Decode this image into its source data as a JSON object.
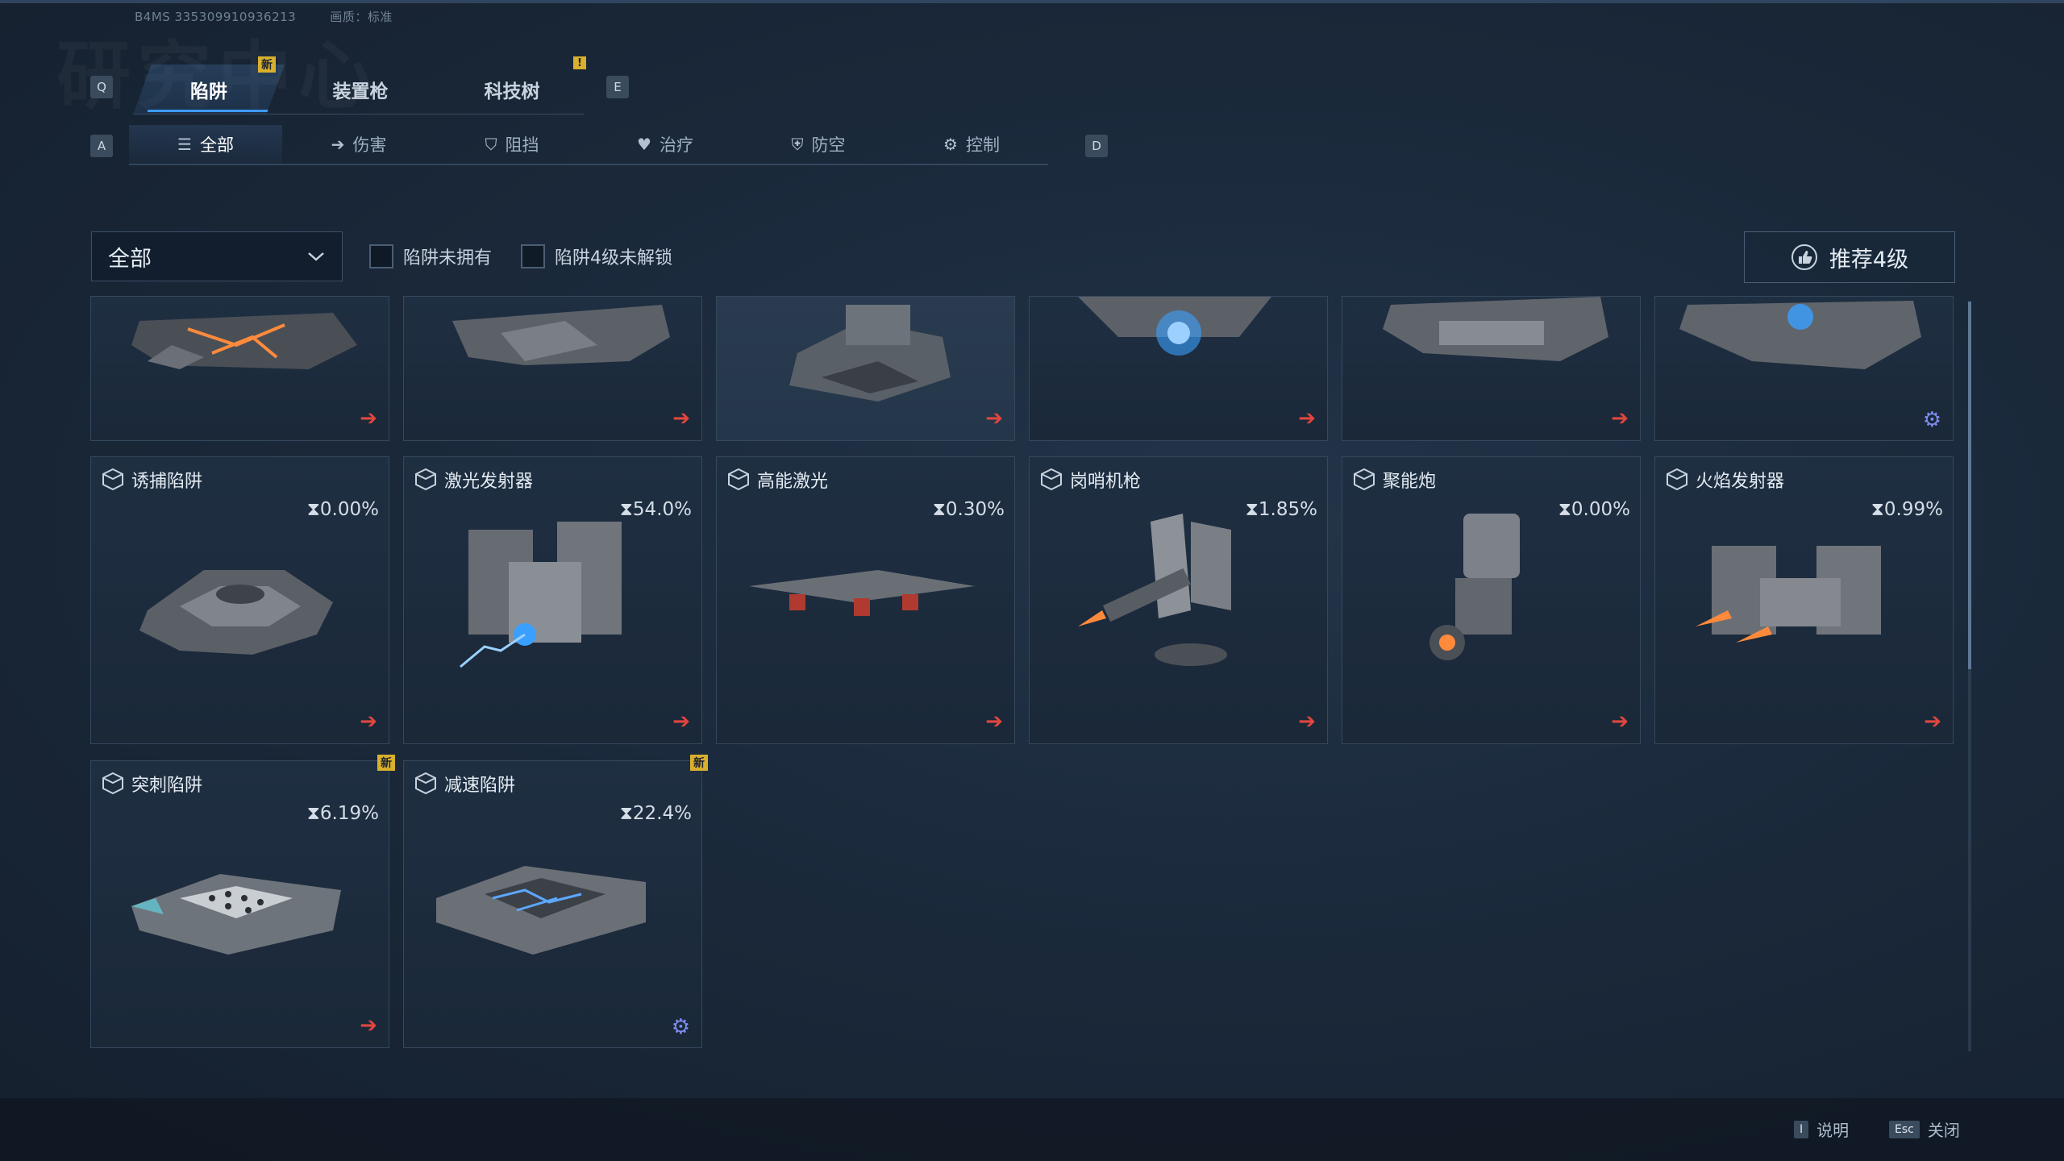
{
  "header": {
    "build_id": "B4MS  3353099109362​13",
    "quality": "画质：标准",
    "watermark": "研究中心"
  },
  "keys": {
    "q": "Q",
    "e": "E",
    "a": "A",
    "d": "D"
  },
  "tabs": [
    {
      "label": "陷阱",
      "active": true
    },
    {
      "label": "装置枪",
      "active": false
    },
    {
      "label": "科技树",
      "active": false
    }
  ],
  "tab_badges": {
    "new": "新",
    "alert": "!"
  },
  "subtabs": [
    {
      "label": "全部",
      "icon": "list-icon"
    },
    {
      "label": "伤害",
      "icon": "arrow-right-icon"
    },
    {
      "label": "阻挡",
      "icon": "shield-icon"
    },
    {
      "label": "治疗",
      "icon": "heart-plus-icon"
    },
    {
      "label": "防空",
      "icon": "anti-air-shield-icon"
    },
    {
      "label": "控制",
      "icon": "gear-icon"
    }
  ],
  "filters": {
    "dropdown_value": "全部",
    "not_owned": "陷阱未拥有",
    "level4_locked": "陷阱4级未解锁",
    "recommend": "推荐4级"
  },
  "cards_row1": [
    {
      "action": "arrow",
      "glow": "#ff8a3c"
    },
    {
      "action": "arrow",
      "glow": "none"
    },
    {
      "action": "arrow",
      "glow": "none",
      "highlight": true
    },
    {
      "action": "arrow",
      "glow": "#3aa0ff"
    },
    {
      "action": "arrow",
      "glow": "none"
    },
    {
      "action": "gear",
      "glow": "#3aa0ff"
    }
  ],
  "cards": [
    {
      "name": "诱捕陷阱",
      "progress": "0.00%",
      "action": "arrow",
      "new": false
    },
    {
      "name": "激光发射器",
      "progress": "54.0%",
      "action": "arrow",
      "new": false
    },
    {
      "name": "高能激光",
      "progress": "0.30%",
      "action": "arrow",
      "new": false
    },
    {
      "name": "岗哨机枪",
      "progress": "1.85%",
      "action": "arrow",
      "new": false
    },
    {
      "name": "聚能炮",
      "progress": "0.00%",
      "action": "arrow",
      "new": false
    },
    {
      "name": "火焰发射器",
      "progress": "0.99%",
      "action": "arrow",
      "new": false
    },
    {
      "name": "突刺陷阱",
      "progress": "6.19%",
      "action": "arrow",
      "new": true
    },
    {
      "name": "减速陷阱",
      "progress": "22.4%",
      "action": "gear",
      "new": true
    }
  ],
  "footer": {
    "help_key": "I",
    "help_label": "说明",
    "close_key": "Esc",
    "close_label": "关闭"
  },
  "colors": {
    "accent": "#3d9bff",
    "badge": "#d9b02e",
    "arrow": "#e0463e",
    "gear": "#7d8cf0"
  }
}
